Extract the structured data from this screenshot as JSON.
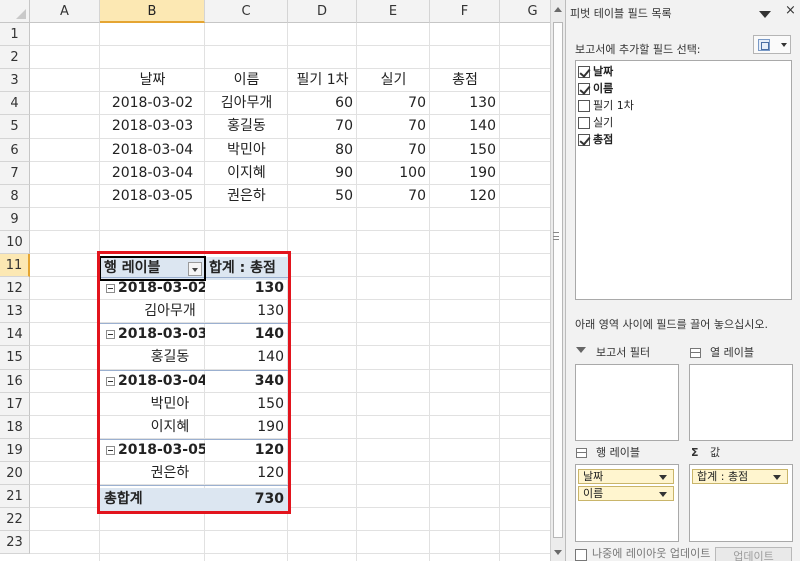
{
  "sheet": {
    "column_headers": [
      "A",
      "B",
      "C",
      "D",
      "E",
      "F",
      "G"
    ],
    "selected_column": "B",
    "row_headers": [
      "1",
      "2",
      "3",
      "4",
      "5",
      "6",
      "7",
      "8",
      "9",
      "10",
      "11",
      "12",
      "13",
      "14",
      "15",
      "16",
      "17",
      "18",
      "19",
      "20",
      "21",
      "22",
      "23"
    ],
    "selected_row": "11",
    "data_table": {
      "headers": [
        "날짜",
        "이름",
        "필기 1차",
        "실기",
        "총점"
      ],
      "rows": [
        [
          "2018-03-02",
          "김아무개",
          "60",
          "70",
          "130"
        ],
        [
          "2018-03-03",
          "홍길동",
          "70",
          "70",
          "140"
        ],
        [
          "2018-03-04",
          "박민아",
          "80",
          "70",
          "150"
        ],
        [
          "2018-03-04",
          "이지혜",
          "90",
          "100",
          "190"
        ],
        [
          "2018-03-05",
          "권은하",
          "50",
          "70",
          "120"
        ]
      ]
    },
    "pivot": {
      "row_label_header": "행 레이블",
      "value_header": "합계 : 총점",
      "rows": [
        {
          "label": "2018-03-02",
          "value": "130",
          "group": true
        },
        {
          "label": "김아무개",
          "value": "130",
          "group": false
        },
        {
          "label": "2018-03-03",
          "value": "140",
          "group": true
        },
        {
          "label": "홍길동",
          "value": "140",
          "group": false
        },
        {
          "label": "2018-03-04",
          "value": "340",
          "group": true
        },
        {
          "label": "박민아",
          "value": "150",
          "group": false
        },
        {
          "label": "이지혜",
          "value": "190",
          "group": false
        },
        {
          "label": "2018-03-05",
          "value": "120",
          "group": true
        },
        {
          "label": "권은하",
          "value": "120",
          "group": false
        }
      ],
      "grand_total_label": "총합계",
      "grand_total_value": "730"
    }
  },
  "pane": {
    "title": "피벗 테이블 필드 목록",
    "close_glyph": "×",
    "choose_fields_label": "보고서에 추가할 필드 선택:",
    "fields": [
      {
        "label": "날짜",
        "checked": true
      },
      {
        "label": "이름",
        "checked": true
      },
      {
        "label": "필기 1차",
        "checked": false
      },
      {
        "label": "실기",
        "checked": false
      },
      {
        "label": "총점",
        "checked": true
      }
    ],
    "drag_instruction": "아래 영역 사이에 필드를 끌어 놓으십시오.",
    "areas": {
      "report_filter": "보고서 필터",
      "column_labels": "열 레이블",
      "row_labels": "행 레이블",
      "values": "값",
      "values_symbol": "Σ"
    },
    "row_chips": [
      "날짜",
      "이름"
    ],
    "value_chips": [
      "합계 : 총점"
    ],
    "defer_label": "나중에 레이아웃 업데이트",
    "update_button": "업데이트"
  }
}
